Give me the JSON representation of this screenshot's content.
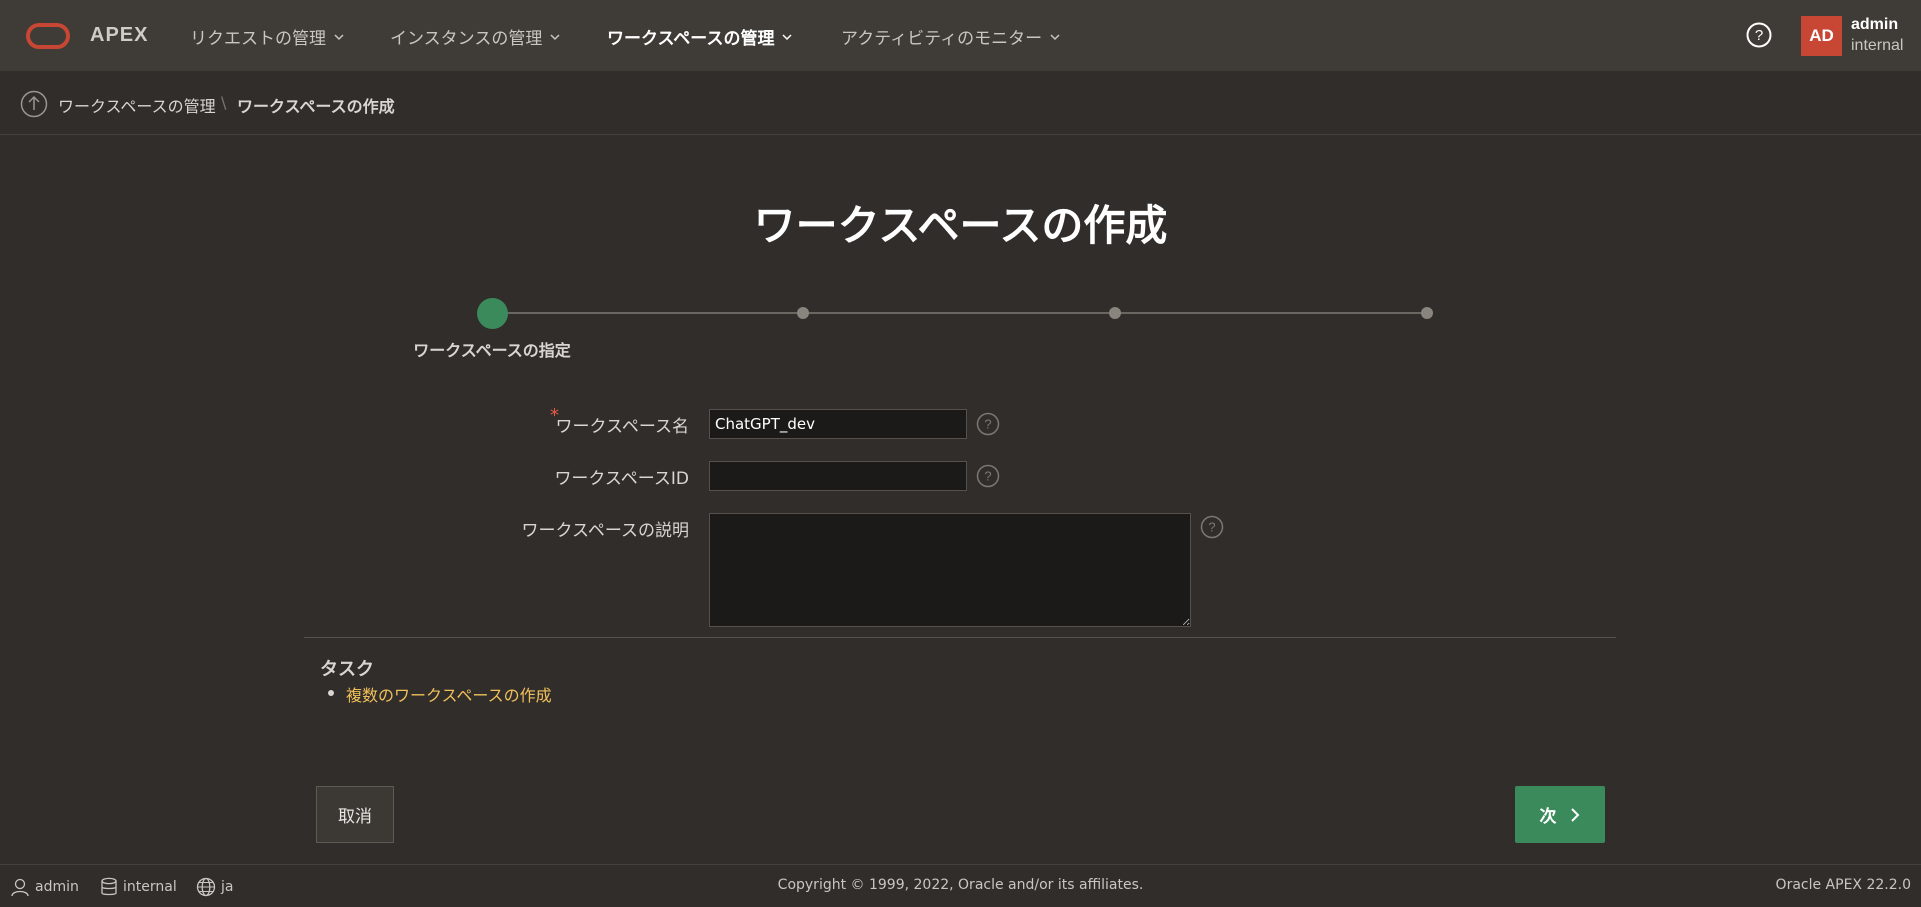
{
  "app": {
    "logo_text": "APEX"
  },
  "nav": {
    "items": [
      {
        "label": "リクエストの管理"
      },
      {
        "label": "インスタンスの管理"
      },
      {
        "label": "ワークスペースの管理"
      },
      {
        "label": "アクティビティのモニター"
      }
    ],
    "active_index": 2
  },
  "user": {
    "initials": "AD",
    "name": "admin",
    "workspace": "internal"
  },
  "breadcrumb": {
    "parent": "ワークスペースの管理",
    "separator": "\\",
    "current": "ワークスペースの作成"
  },
  "page": {
    "title": "ワークスペースの作成"
  },
  "wizard": {
    "current_step": 1,
    "total_steps": 4,
    "current_step_label": "ワークスペースの指定"
  },
  "form": {
    "workspace_name": {
      "label": "ワークスペース名",
      "value": "ChatGPT_dev",
      "required_mark": "*"
    },
    "workspace_id": {
      "label": "ワークスペースID",
      "value": ""
    },
    "workspace_description": {
      "label": "ワークスペースの説明",
      "value": ""
    }
  },
  "tasks": {
    "title": "タスク",
    "items": [
      {
        "label": "複数のワークスペースの作成"
      }
    ]
  },
  "buttons": {
    "cancel": "取消",
    "next": "次"
  },
  "footer": {
    "user": "admin",
    "workspace": "internal",
    "language": "ja",
    "copyright": "Copyright © 1999, 2022, Oracle and/or its affiliates.",
    "version": "Oracle APEX 22.2.0"
  },
  "colors": {
    "accent_green": "#3b8a5c",
    "brand_red": "#c74634",
    "link_yellow": "#f0c05a"
  },
  "icons": [
    "oracle-logo-icon",
    "chevron-down-icon",
    "help-icon",
    "up-arrow-icon",
    "chevron-right-icon",
    "user-icon",
    "database-icon",
    "globe-icon"
  ]
}
